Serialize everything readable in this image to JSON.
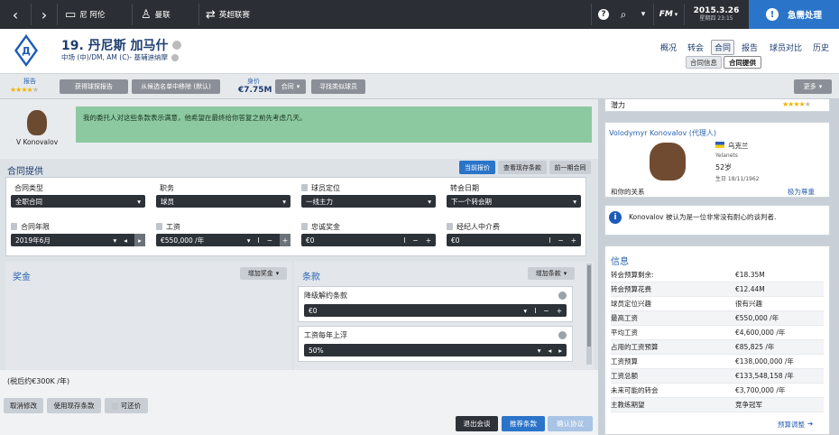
{
  "topbar": {
    "team_name": "尼 阿伦",
    "league_label": "曼联",
    "competition_label": "英超联赛",
    "fm_label": "FM",
    "date": "2015.3.26",
    "time": "星期四 23:15",
    "urgent_label": "急需处理"
  },
  "header": {
    "player_name": "19. 丹尼斯 加马什",
    "player_positions": "中场 (中)/DM, AM (C)- 基辅迪纳摩",
    "nav": [
      "概况",
      "转会",
      "合同",
      "报告",
      "球员对比",
      "历史"
    ],
    "nav_active": "合同",
    "subnav": [
      "合同信息",
      "合同提供"
    ],
    "subnav_active": "合同提供"
  },
  "toolbar": {
    "report_label": "报告",
    "report_stars": 4,
    "get_report_button": "获得球探报告",
    "remove_shortlist_button": "从候选名单中移除 (默认)",
    "value_label": "身价",
    "value": "€7.75M",
    "contract_button": "合同",
    "find_similar_button": "寻找类似球员",
    "more_button": "更多"
  },
  "message": {
    "speaker": "V Konovalov",
    "text": "我的委托人对这些条款表示满意，他希望在最终给你答复之前先考虑几天。"
  },
  "offer": {
    "section_title": "合同提供",
    "tabs": [
      "当前报价",
      "查看现存条款",
      "前一期合同"
    ],
    "tab_active": "当前报价",
    "fields": {
      "contract_type": {
        "label": "合同类型",
        "value": "全职合同"
      },
      "role": {
        "label": "职务",
        "value": "球员"
      },
      "squad_status": {
        "label": "球员定位",
        "value": "一线主力"
      },
      "transfer_date": {
        "label": "转会日期",
        "value": "下一个转会期"
      },
      "contract_end": {
        "label": "合同年限",
        "value": "2019年6月"
      },
      "wage": {
        "label": "工资",
        "value": "€550,000 /年"
      },
      "loyalty_bonus": {
        "label": "忠诚奖金",
        "value": "€0"
      },
      "agent_fee": {
        "label": "经纪人中介费",
        "value": "€0"
      }
    }
  },
  "bonus": {
    "title": "奖金",
    "add_button": "增加奖金"
  },
  "clauses": {
    "title": "条款",
    "add_button": "增加条款",
    "items": [
      {
        "label": "降级解约条款",
        "value": "€0"
      },
      {
        "label": "工资每年上浮",
        "value": "50%"
      }
    ]
  },
  "bottom": {
    "after_tax": "(税后约€300K /年)",
    "cancel_button": "取消修改",
    "use_existing_button": "使用现存条款",
    "negotiable_button": "可还价",
    "leave_button": "退出会谈",
    "propose_button": "推荐条款",
    "confirm_button": "确认协议"
  },
  "sidebar": {
    "potential_label": "潜力",
    "potential_stars": 4,
    "agent_name": "Volodymyr Konovalov (代理人)",
    "agent_country": "乌克兰",
    "agent_agency": "Yelanets",
    "agent_age": "52岁",
    "agent_birth": "生日 18/11/1962",
    "relation_label": "和你的关系",
    "relation_value": "极为尊重",
    "agent_note": "Konovalov 被认为是一位非常没有耐心的谈判者.",
    "info_title": "信息",
    "info_rows": [
      {
        "k": "转会预算剩余:",
        "v": "€18.35M"
      },
      {
        "k": "转会预算花费",
        "v": "€12.44M"
      },
      {
        "k": "球员定位兴趣",
        "v": "很有兴趣"
      },
      {
        "k": "最高工资",
        "v": "€550,000 /年"
      },
      {
        "k": "平均工资",
        "v": "€4,600,000 /年"
      },
      {
        "k": "占用的工资预算",
        "v": "€85,825 /年"
      },
      {
        "k": "工资预算",
        "v": "€138,000,000 /年"
      },
      {
        "k": "工资总额",
        "v": "€133,548,158 /年"
      },
      {
        "k": "未来可能的转会",
        "v": "€3,700,000 /年"
      },
      {
        "k": "主教练期望",
        "v": "竞争冠军"
      }
    ],
    "budget_adjust": "预算调整"
  },
  "colors": {
    "accent": "#2a74c9",
    "topbar": "#2b2f35",
    "message_bg": "#8cc9a0",
    "star": "#f0b400"
  }
}
